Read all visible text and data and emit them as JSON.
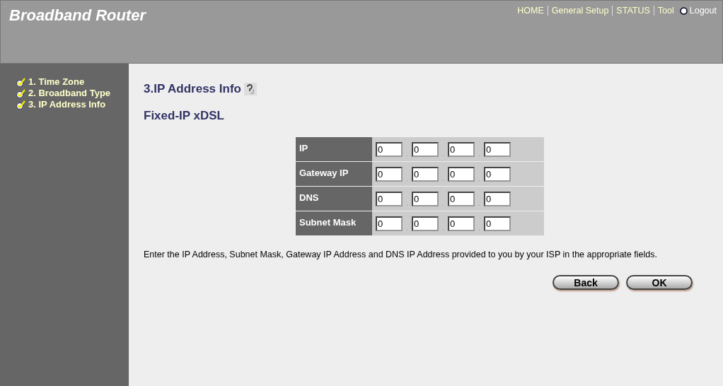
{
  "header": {
    "title": "Broadband Router",
    "nav": [
      {
        "label": "HOME",
        "kind": "link"
      },
      {
        "label": "General Setup",
        "kind": "link"
      },
      {
        "label": "STATUS",
        "kind": "link"
      },
      {
        "label": "Tool",
        "kind": "link"
      },
      {
        "label": "Logout",
        "kind": "logout"
      }
    ]
  },
  "sidebar": {
    "items": [
      {
        "label": "1. Time Zone",
        "checked": true
      },
      {
        "label": "2. Broadband Type",
        "checked": true
      },
      {
        "label": "3. IP Address Info",
        "checked": true
      }
    ]
  },
  "main": {
    "heading": "3.IP Address Info",
    "subheading": "Fixed-IP xDSL",
    "rows": [
      {
        "label": "IP",
        "octets": [
          "0",
          "0",
          "0",
          "0"
        ],
        "separators": [
          ".",
          ".",
          "."
        ]
      },
      {
        "label": "Gateway IP",
        "octets": [
          "0",
          "0",
          "0",
          "0"
        ],
        "separators": [
          ".",
          ".",
          "."
        ]
      },
      {
        "label": "DNS",
        "octets": [
          "0",
          "0",
          "0",
          "0"
        ],
        "separators": [
          ".",
          ".",
          "."
        ]
      },
      {
        "label": "Subnet Mask",
        "octets": [
          "0",
          "0",
          "0",
          "0"
        ],
        "separators": [
          ".",
          ".",
          "."
        ]
      }
    ],
    "description": "Enter the IP Address, Subnet Mask, Gateway IP Address and DNS IP Address provided to you by your ISP in the appropriate fields.",
    "buttons": [
      "Back",
      "OK"
    ]
  }
}
